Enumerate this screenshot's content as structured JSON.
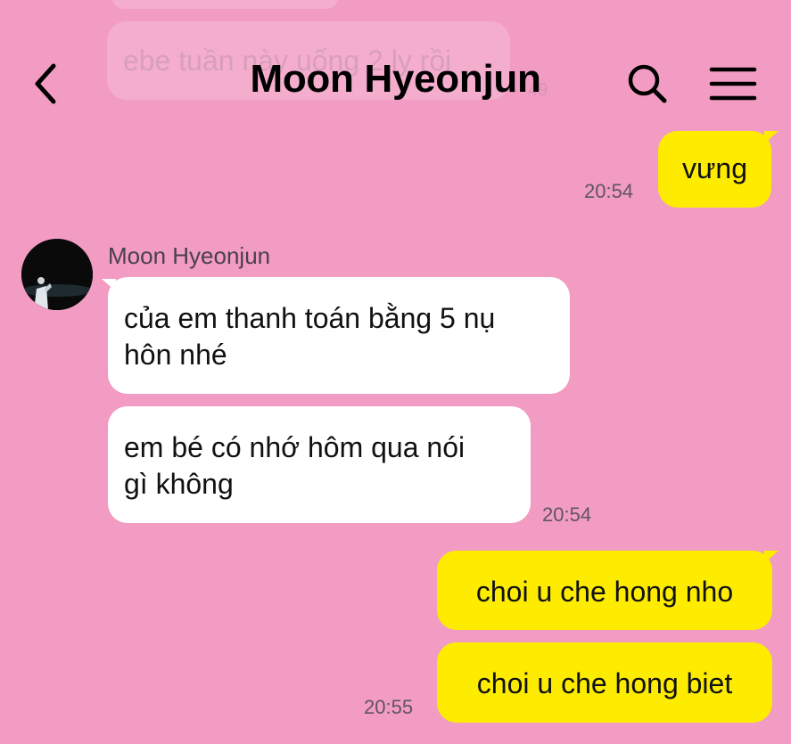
{
  "header": {
    "title": "Moon Hyeonjun"
  },
  "icons": {
    "back": "chevron-left-icon",
    "search": "search-icon",
    "menu": "hamburger-menu-icon"
  },
  "faded_background": {
    "message": "ebe tuần này uống 2 ly rồi",
    "time": "49"
  },
  "messages": [
    {
      "direction": "out",
      "text": "vưng",
      "time": "20:54"
    },
    {
      "direction": "in",
      "sender": "Moon Hyeonjun",
      "text_lines": [
        "của em thanh toán bằng 5 nụ",
        "hôn nhé"
      ]
    },
    {
      "direction": "in",
      "text_lines": [
        "em bé có nhớ hôm qua nói",
        "gì không"
      ],
      "time": "20:54"
    },
    {
      "direction": "out",
      "text": "choi u che hong nho"
    },
    {
      "direction": "out",
      "text": "choi u che hong biet",
      "time": "20:55"
    }
  ],
  "colors": {
    "background": "#f29cc3",
    "outgoing_bubble": "#fdec00",
    "incoming_bubble": "#ffffff",
    "time_text": "#5f5560"
  }
}
